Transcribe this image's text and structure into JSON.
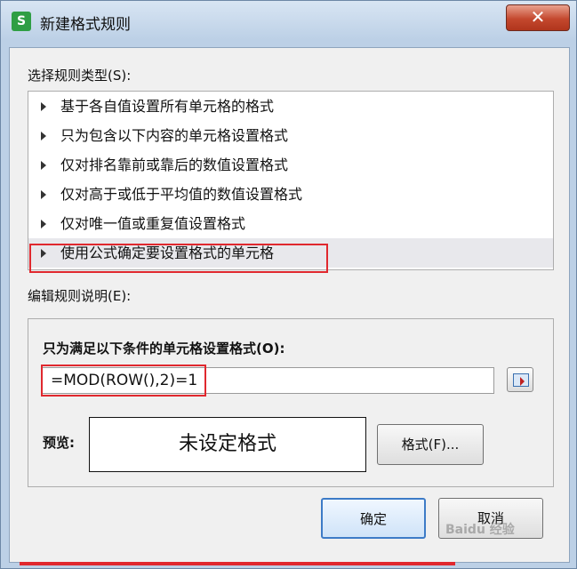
{
  "window": {
    "app_icon_letter": "S",
    "title": "新建格式规则",
    "close_glyph": "✕"
  },
  "rule_type": {
    "label": "选择规则类型(S):",
    "items": [
      {
        "label": "基于各自值设置所有单元格的格式",
        "selected": false
      },
      {
        "label": "只为包含以下内容的单元格设置格式",
        "selected": false
      },
      {
        "label": "仅对排名靠前或靠后的数值设置格式",
        "selected": false
      },
      {
        "label": "仅对高于或低于平均值的数值设置格式",
        "selected": false
      },
      {
        "label": "仅对唯一值或重复值设置格式",
        "selected": false
      },
      {
        "label": "使用公式确定要设置格式的单元格",
        "selected": true
      }
    ]
  },
  "rule_description": {
    "label": "编辑规则说明(E):",
    "condition_label": "只为满足以下条件的单元格设置格式(O):",
    "formula_value": "=MOD(ROW(),2)=1",
    "preview_label": "预览:",
    "preview_text": "未设定格式",
    "format_button": "格式(F)..."
  },
  "buttons": {
    "ok": "确定",
    "cancel": "取消"
  },
  "watermark": "Baidu 经验",
  "colors": {
    "highlight": "#e0282e",
    "dialog_bg": "#f0f0f0",
    "title_bg": "#bcd0e6"
  }
}
